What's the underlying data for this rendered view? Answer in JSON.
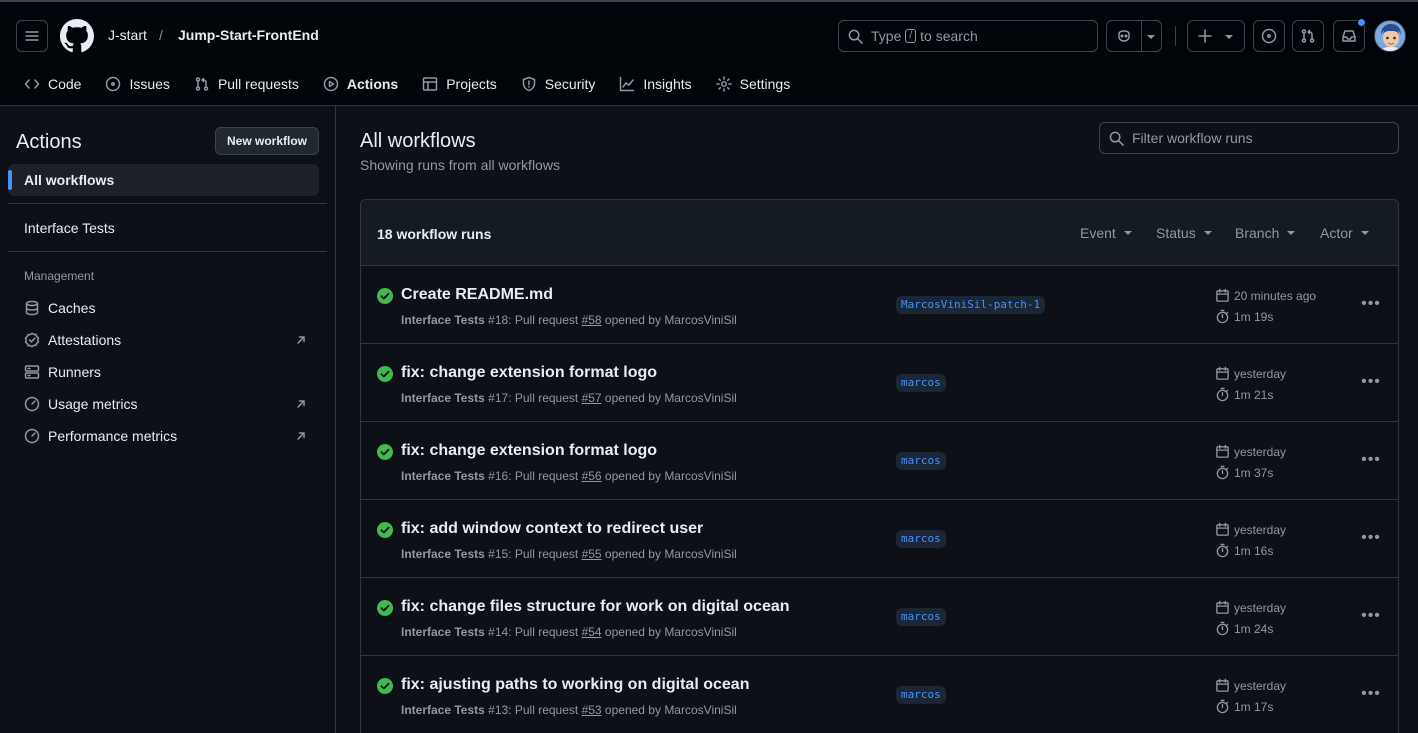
{
  "header": {
    "owner": "J-start",
    "separator": "/",
    "repo": "Jump-Start-FrontEnd",
    "search_prefix": "Type",
    "search_key": "/",
    "search_suffix": "to search"
  },
  "tabs": [
    {
      "label": "Code",
      "icon": "code-icon"
    },
    {
      "label": "Issues",
      "icon": "issue-icon"
    },
    {
      "label": "Pull requests",
      "icon": "pull-request-icon"
    },
    {
      "label": "Actions",
      "icon": "play-icon"
    },
    {
      "label": "Projects",
      "icon": "table-icon"
    },
    {
      "label": "Security",
      "icon": "shield-icon"
    },
    {
      "label": "Insights",
      "icon": "graph-icon"
    },
    {
      "label": "Settings",
      "icon": "gear-icon"
    }
  ],
  "sidebar": {
    "title": "Actions",
    "new_workflow": "New workflow",
    "all_workflows": "All workflows",
    "workflows": [
      "Interface Tests"
    ],
    "management_heading": "Management",
    "management": [
      {
        "label": "Caches",
        "icon": "database-icon",
        "external": false
      },
      {
        "label": "Attestations",
        "icon": "verified-icon",
        "external": true
      },
      {
        "label": "Runners",
        "icon": "server-icon",
        "external": false
      },
      {
        "label": "Usage metrics",
        "icon": "meter-icon",
        "external": true
      },
      {
        "label": "Performance metrics",
        "icon": "meter-icon",
        "external": true
      }
    ]
  },
  "main": {
    "title": "All workflows",
    "subtitle": "Showing runs from all workflows",
    "filter_placeholder": "Filter workflow runs",
    "run_count": "18 workflow runs",
    "filters": [
      "Event",
      "Status",
      "Branch",
      "Actor"
    ],
    "runs": [
      {
        "title": "Create README.md",
        "workflow": "Interface Tests",
        "run": "#18",
        "text": ": Pull request ",
        "pr": "#58",
        "opened": " opened by MarcosViniSil",
        "branch": "MarcosViniSil-patch-1",
        "when": "20 minutes ago",
        "duration": "1m 19s"
      },
      {
        "title": "fix: change extension format logo",
        "workflow": "Interface Tests",
        "run": "#17",
        "text": ": Pull request ",
        "pr": "#57",
        "opened": " opened by MarcosViniSil",
        "branch": "marcos",
        "when": "yesterday",
        "duration": "1m 21s"
      },
      {
        "title": "fix: change extension format logo",
        "workflow": "Interface Tests",
        "run": "#16",
        "text": ": Pull request ",
        "pr": "#56",
        "opened": " opened by MarcosViniSil",
        "branch": "marcos",
        "when": "yesterday",
        "duration": "1m 37s"
      },
      {
        "title": "fix: add window context to redirect user",
        "workflow": "Interface Tests",
        "run": "#15",
        "text": ": Pull request ",
        "pr": "#55",
        "opened": " opened by MarcosViniSil",
        "branch": "marcos",
        "when": "yesterday",
        "duration": "1m 16s"
      },
      {
        "title": "fix: change files structure for work on digital ocean",
        "workflow": "Interface Tests",
        "run": "#14",
        "text": ": Pull request ",
        "pr": "#54",
        "opened": " opened by MarcosViniSil",
        "branch": "marcos",
        "when": "yesterday",
        "duration": "1m 24s"
      },
      {
        "title": "fix: ajusting paths to working on digital ocean",
        "workflow": "Interface Tests",
        "run": "#13",
        "text": ": Pull request ",
        "pr": "#53",
        "opened": " opened by MarcosViniSil",
        "branch": "marcos",
        "when": "yesterday",
        "duration": "1m 17s"
      }
    ]
  },
  "colors": {
    "accent": "#f78166",
    "success": "#3fb950",
    "link": "#4493f8",
    "notification": "#4493f8"
  }
}
